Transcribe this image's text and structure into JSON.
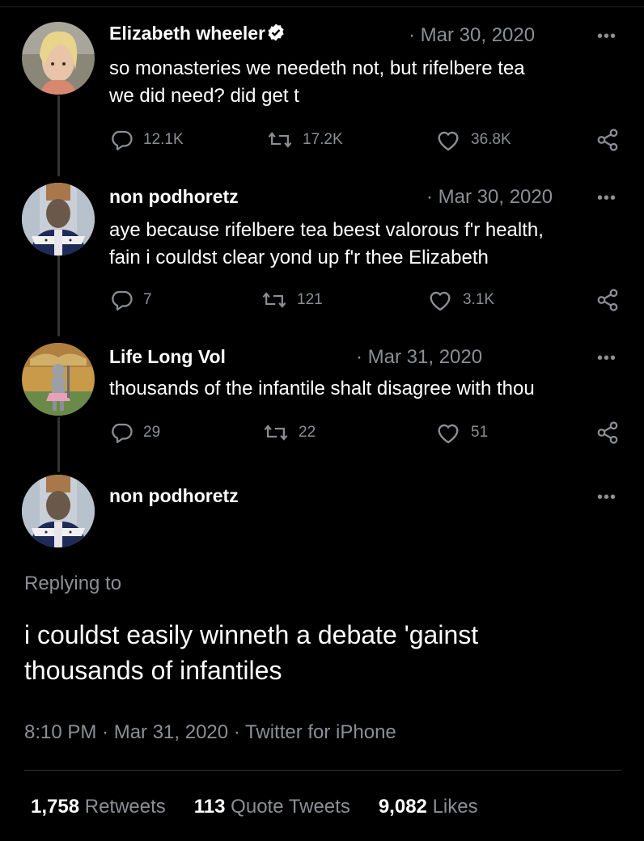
{
  "thread": [
    {
      "name": "Elizabeth wheeler",
      "verified": true,
      "date": "· Mar 30, 2020",
      "more": "•••",
      "text_lines": [
        "so monasteries we needeth not, but rifelbere tea",
        "we did need? did get t"
      ],
      "replies": "12.1K",
      "retweets": "17.2K",
      "likes": "36.8K"
    },
    {
      "name": "non podhoretz",
      "date": "· Mar 30, 2020",
      "more": "•••",
      "text_lines": [
        "aye because rifelbere tea beest valorous f'r health,",
        "fain i couldst clear yond up f'r thee Elizabeth"
      ],
      "replies": "7",
      "retweets": "121",
      "likes": "3.1K"
    },
    {
      "name": "Life Long Vol",
      "date": "· Mar 31, 2020",
      "more": "•••",
      "text_lines": [
        "thousands of the infantile shalt disagree with thou"
      ],
      "replies": "29",
      "retweets": "22",
      "likes": "51"
    }
  ],
  "main_tweet": {
    "name": "non podhoretz",
    "more": "•••",
    "replying_to": "Replying to",
    "text_lines": [
      "i couldst easily winneth a debate 'gainst",
      "thousands of infantiles"
    ],
    "meta": "8:10 PM · Mar 31, 2020 · Twitter for iPhone",
    "stats": {
      "retweets_count": "1,758",
      "retweets_label": "Retweets",
      "quotes_count": "113",
      "quotes_label": "Quote Tweets",
      "likes_count": "9,082",
      "likes_label": "Likes"
    }
  },
  "colors": {
    "background": "#000000",
    "secondary_text": "#8b8f94",
    "verified_badge": "#ffffff"
  }
}
